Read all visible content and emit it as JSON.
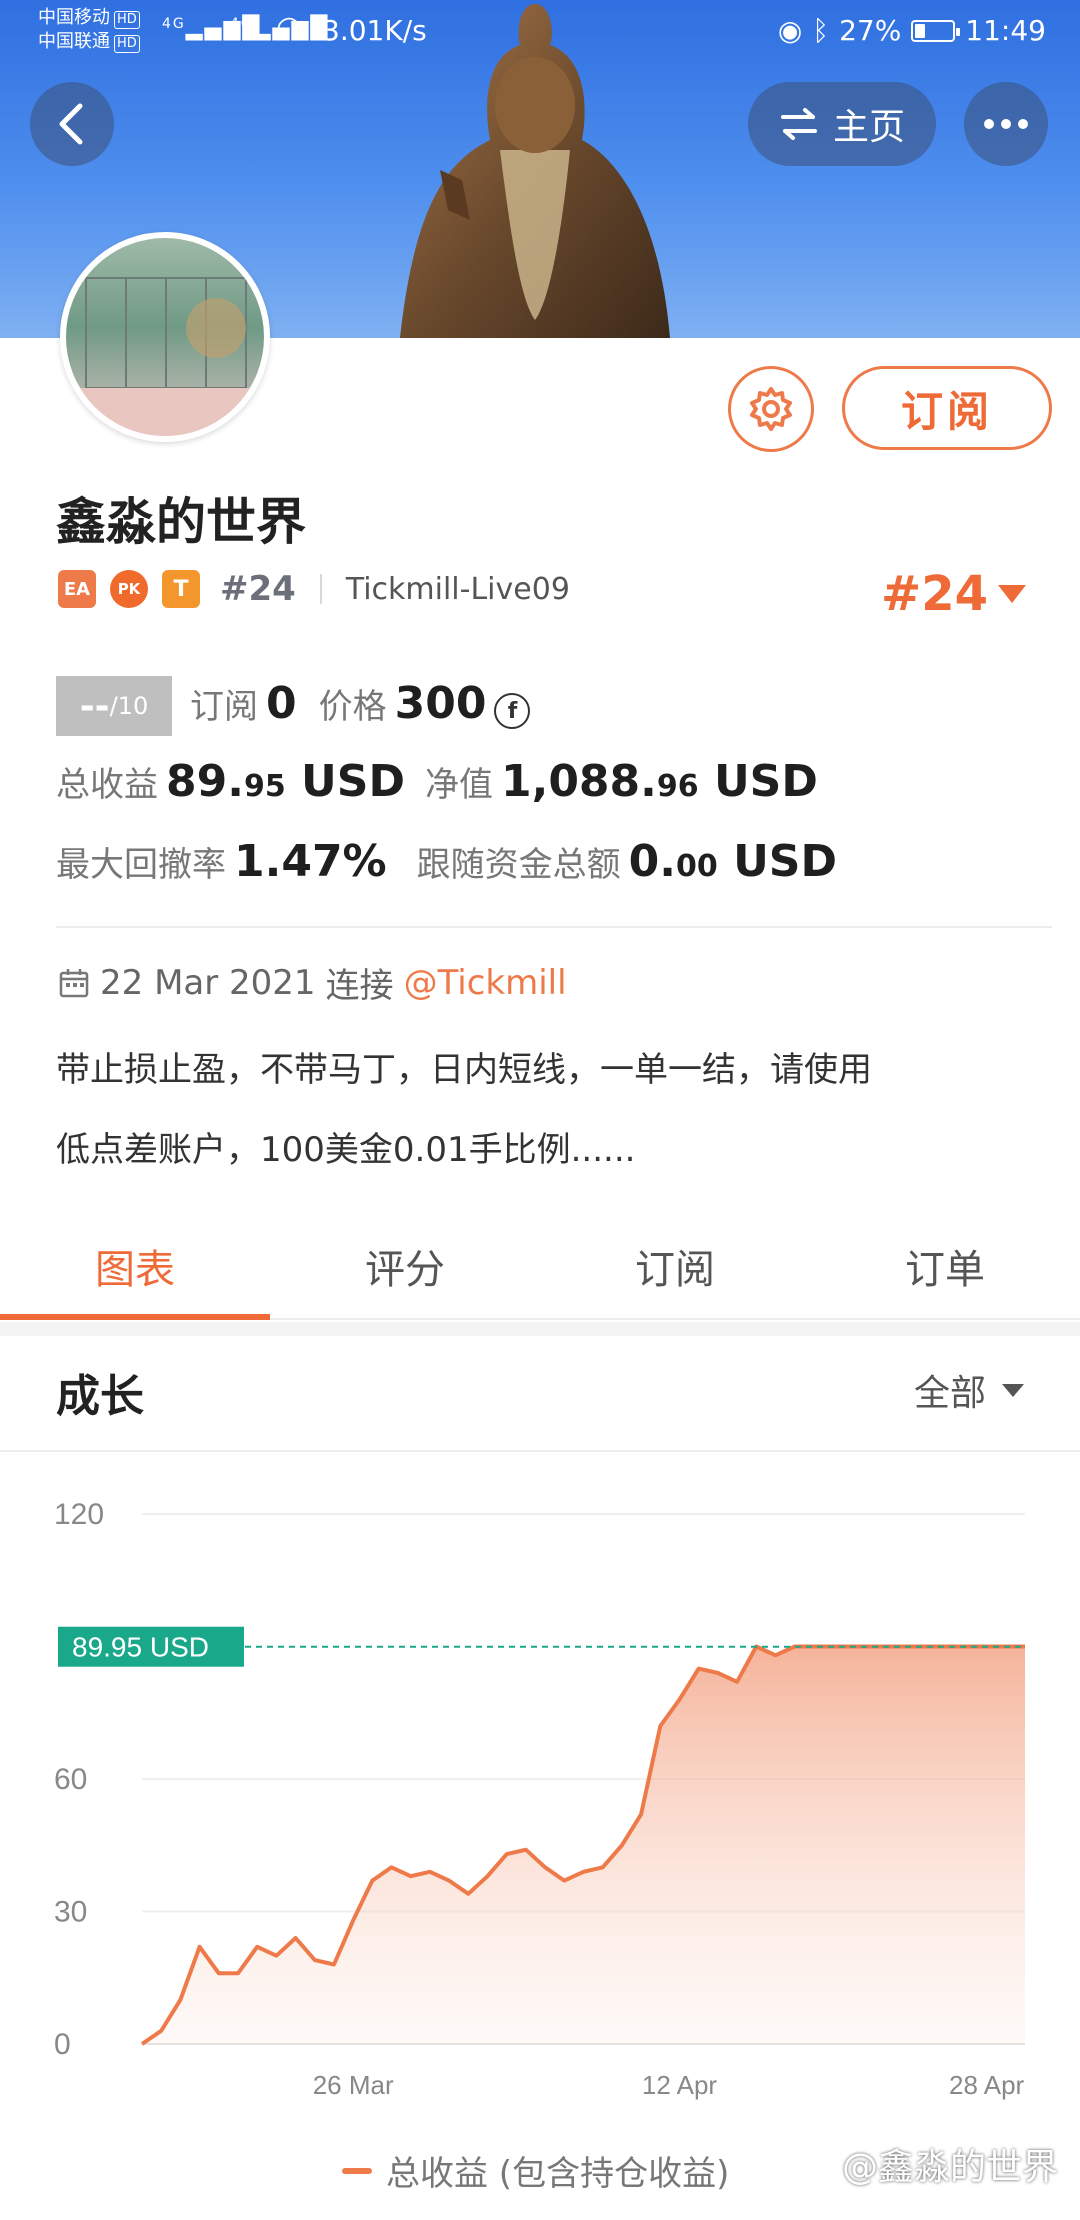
{
  "status_bar": {
    "carrier_1": "中国移动",
    "carrier_2": "中国联通",
    "hd": "HD",
    "net_1": "4G",
    "net_2": "4G",
    "speed": "3.01K/s",
    "battery": "27%",
    "battery_fraction": 0.27,
    "time": "11:49"
  },
  "header": {
    "home_label": "主页",
    "subscribe_label": "订阅"
  },
  "profile": {
    "name": "鑫淼的世界",
    "badges": [
      "EA",
      "PK",
      "T"
    ],
    "rank_small": "#24",
    "broker": "Tickmill-Live09",
    "rank_big": "#24"
  },
  "stats": {
    "score": "--",
    "score_max": "/10",
    "subscribe_label": "订阅",
    "subscribe_count": "0",
    "price_label": "价格",
    "price_value": "300",
    "price_icon": "f",
    "total_profit_label": "总收益",
    "total_profit_int": "89.",
    "total_profit_dec": "95",
    "total_profit_unit": "USD",
    "equity_label": "净值",
    "equity_int": "1,088.",
    "equity_dec": "96",
    "equity_unit": "USD",
    "drawdown_label": "最大回撤率",
    "drawdown_value": "1.47%",
    "follow_label": "跟随资金总额",
    "follow_int": "0.",
    "follow_dec": "00",
    "follow_unit": "USD"
  },
  "info": {
    "date": "22 Mar 2021",
    "connect_label": "连接",
    "link": "@Tickmill",
    "desc_line1": "带止损止盈，不带马丁，日内短线，一单一结，请使用",
    "desc_line2": "低点差账户，100美金0.01手比例......"
  },
  "tabs": [
    {
      "label": "图表"
    },
    {
      "label": "评分"
    },
    {
      "label": "订阅"
    },
    {
      "label": "订单"
    }
  ],
  "growth": {
    "title": "成长",
    "filter": "全部",
    "legend": "总收益 (包含持仓收益)",
    "watermark": "@鑫淼的世界"
  },
  "colors": {
    "accent": "#ee6a36",
    "line": "#ee7a4a",
    "current_tag": "#19a98a"
  },
  "chart_data": {
    "type": "area",
    "title": "成长",
    "y_ticks": [
      0,
      30,
      60,
      120
    ],
    "ylim": [
      0,
      120
    ],
    "x_tick_labels": [
      "26 Mar",
      "12 Apr",
      "28 Apr"
    ],
    "x_tick_positions": [
      11,
      28,
      44
    ],
    "current_value_label": "89.95 USD",
    "current_value": 89.95,
    "series": [
      {
        "name": "总收益 (包含持仓收益)",
        "x": [
          0,
          1,
          2,
          3,
          4,
          5,
          6,
          7,
          8,
          9,
          10,
          11,
          12,
          13,
          14,
          15,
          16,
          17,
          18,
          19,
          20,
          21,
          22,
          23,
          24,
          25,
          26,
          27,
          28,
          29,
          30,
          31,
          32,
          33,
          34,
          35,
          36,
          37,
          38,
          39,
          40,
          41,
          42,
          43,
          44,
          45,
          46
        ],
        "y": [
          0,
          3,
          10,
          22,
          16,
          16,
          22,
          20,
          24,
          19,
          18,
          28,
          37,
          40,
          38,
          39,
          37,
          34,
          38,
          43,
          44,
          40,
          37,
          39,
          40,
          45,
          52,
          72,
          78,
          85,
          84,
          82,
          90,
          88,
          90,
          90,
          90,
          90,
          90,
          90,
          90,
          90,
          90,
          90,
          90,
          90,
          90
        ]
      }
    ]
  }
}
